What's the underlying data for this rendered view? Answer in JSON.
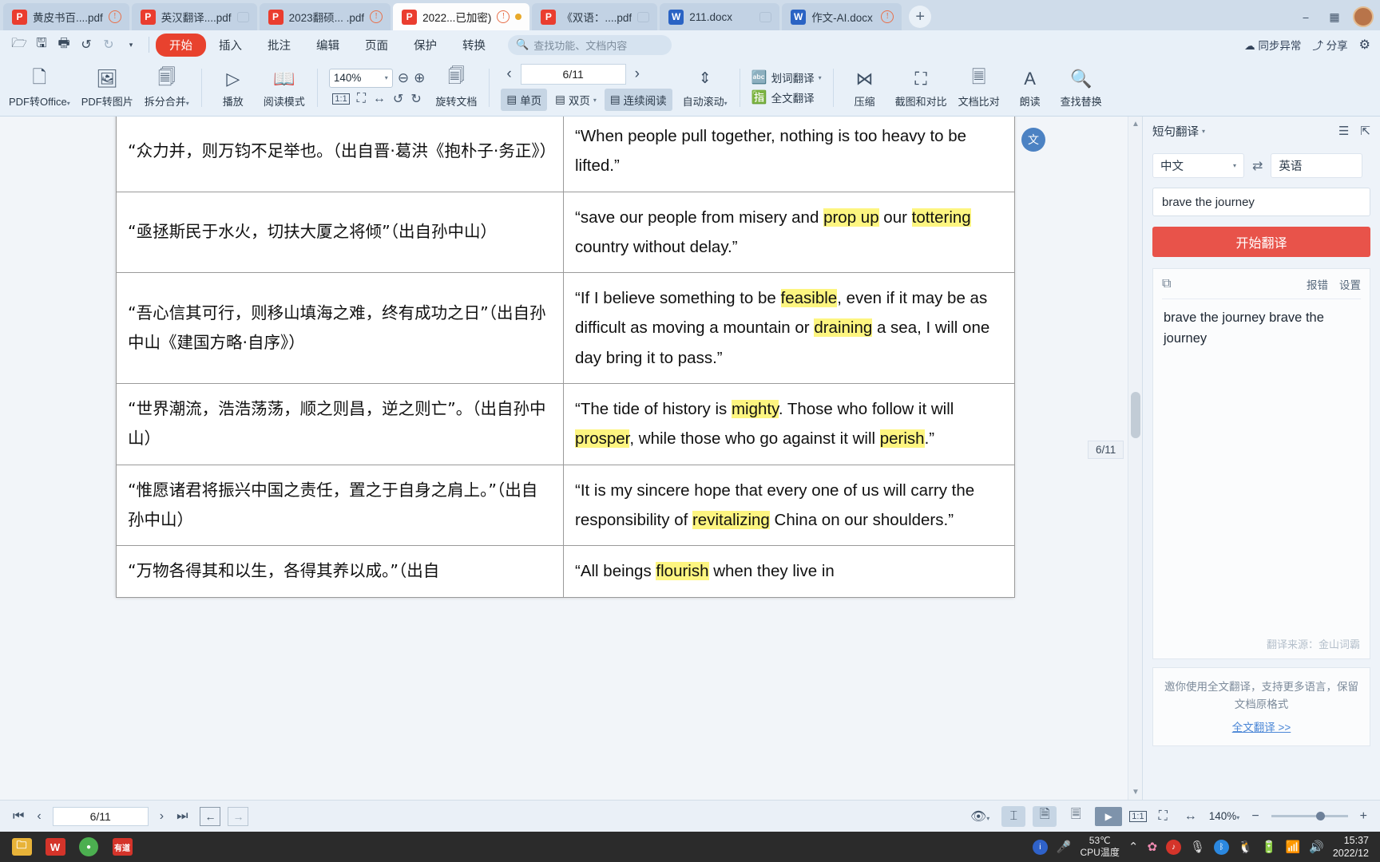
{
  "tabbar": {
    "tabs": [
      {
        "icon": "pdf-file-icon",
        "title": "黄皮书百....pdf",
        "active": false,
        "badges": [
          "warning-icon"
        ]
      },
      {
        "icon": "pdf-file-icon",
        "title": "英汉翻译....pdf",
        "active": false,
        "badges": [
          "chat-icon"
        ]
      },
      {
        "icon": "pdf-file-icon",
        "title": "2023翻硕... .pdf",
        "active": false,
        "badges": [
          "warning-icon"
        ]
      },
      {
        "icon": "pdf-file-icon",
        "title": "2022...已加密)",
        "active": true,
        "badges": [
          "warning-icon",
          "dot-icon"
        ]
      },
      {
        "icon": "pdf-file-icon",
        "title": "《双语：....pdf",
        "active": false,
        "badges": [
          "chat-icon"
        ]
      },
      {
        "icon": "word-file-icon",
        "title": "211.docx",
        "active": false,
        "badges": [
          "chat-icon"
        ]
      },
      {
        "icon": "word-file-icon",
        "title": "作文-AI.docx",
        "active": false,
        "badges": [
          "warning-icon"
        ]
      }
    ],
    "new_tab": "+",
    "window_buttons": [
      "minimize",
      "maximize",
      "grid"
    ]
  },
  "menubar": {
    "quick_icons": [
      "open-folder-icon",
      "save-icon",
      "print-icon",
      "undo-icon",
      "redo-icon",
      "more-icon"
    ],
    "items": [
      "开始",
      "插入",
      "批注",
      "编辑",
      "页面",
      "保护",
      "转换"
    ],
    "active_item": "开始",
    "search_placeholder": "查找功能、文档内容",
    "sync_status": "同步异常",
    "share": "分享",
    "settings_icon": "gear-icon"
  },
  "ribbon": {
    "buttons": [
      {
        "label": "PDF转Office",
        "icon": "pdf-to-office-icon",
        "caret": true
      },
      {
        "label": "PDF转图片",
        "icon": "pdf-to-image-icon",
        "caret": false
      },
      {
        "label": "拆分合并",
        "icon": "split-merge-icon",
        "caret": true
      },
      {
        "label": "播放",
        "icon": "play-icon",
        "caret": false
      },
      {
        "label": "阅读模式",
        "icon": "book-icon",
        "caret": false
      }
    ],
    "zoom": {
      "value": "140%",
      "zoom_out_icon": "zoom-out-icon",
      "zoom_in_icon": "zoom-in-icon",
      "mini_icons": [
        "actual-size-icon",
        "fit-page-icon",
        "fit-width-icon",
        "rotate-left-icon",
        "rotate-right-icon"
      ]
    },
    "rotate_doc": {
      "label": "旋转文档",
      "icon": "rotate-document-icon"
    },
    "page_nav": {
      "prev": "‹",
      "value": "6/11",
      "next": "›"
    },
    "view_modes": [
      {
        "label": "单页",
        "icon": "single-page-icon",
        "on": true,
        "caret": false
      },
      {
        "label": "双页",
        "icon": "double-page-icon",
        "on": false,
        "caret": true
      },
      {
        "label": "连续阅读",
        "icon": "continuous-read-icon",
        "on": true,
        "caret": false
      }
    ],
    "auto_scroll": {
      "label": "自动滚动",
      "icon": "auto-scroll-icon",
      "caret": true
    },
    "translate_group": [
      {
        "label": "划词翻译",
        "icon": "word-translate-icon",
        "caret": true
      },
      {
        "label": "全文翻译",
        "icon": "full-translate-icon",
        "caret": false
      }
    ],
    "tools": [
      {
        "label": "压缩",
        "icon": "compress-icon"
      },
      {
        "label": "截图和对比",
        "icon": "screenshot-compare-icon"
      },
      {
        "label": "文档比对",
        "icon": "document-compare-icon"
      },
      {
        "label": "朗读",
        "icon": "read-aloud-icon"
      },
      {
        "label": "查找替换",
        "icon": "find-replace-icon"
      }
    ]
  },
  "document": {
    "page_tooltip": "6/11",
    "rows": [
      {
        "zh": "“众力并，则万钧不足举也。（出自晋·葛洪《抱朴子·务正》）",
        "en_parts": [
          {
            "t": "“When people pull together, nothing is too heavy to be lifted.”",
            "h": false
          }
        ]
      },
      {
        "zh": "“亟拯斯民于水火，切扶大厦之将倾”（出自孙中山）",
        "en_parts": [
          {
            "t": "“save our people from misery and ",
            "h": false
          },
          {
            "t": "prop up",
            "h": true
          },
          {
            "t": " our ",
            "h": false
          },
          {
            "t": "tottering",
            "h": true
          },
          {
            "t": " country without delay.”",
            "h": false
          }
        ]
      },
      {
        "zh": "“吾心信其可行，则移山填海之难，终有成功之日”（出自孙中山《建国方略·自序》）",
        "en_parts": [
          {
            "t": "“If I believe something to be ",
            "h": false
          },
          {
            "t": "feasible",
            "h": true
          },
          {
            "t": ", even if it may be as difficult as moving a mountain or ",
            "h": false
          },
          {
            "t": "draining",
            "h": true
          },
          {
            "t": " a sea, I will one day bring it to pass.”",
            "h": false
          }
        ]
      },
      {
        "zh": "“世界潮流，浩浩荡荡，顺之则昌，逆之则亡”。（出自孙中山）",
        "en_parts": [
          {
            "t": "“The tide of history is ",
            "h": false
          },
          {
            "t": "mighty",
            "h": true
          },
          {
            "t": ". Those who follow it will ",
            "h": false
          },
          {
            "t": "prosper",
            "h": true
          },
          {
            "t": ", while those who go against it will ",
            "h": false
          },
          {
            "t": "perish",
            "h": true
          },
          {
            "t": ".”",
            "h": false
          }
        ]
      },
      {
        "zh": "“惟愿诸君将振兴中国之责任，置之于自身之肩上。”（出自孙中山）",
        "en_parts": [
          {
            "t": "“It is my sincere hope that every one of us will carry the responsibility of ",
            "h": false
          },
          {
            "t": "revitalizing",
            "h": true
          },
          {
            "t": " China on our shoulders.”",
            "h": false
          }
        ]
      },
      {
        "zh": "“万物各得其和以生，各得其养以成。”（出自",
        "en_parts": [
          {
            "t": "“All beings ",
            "h": false
          },
          {
            "t": "flourish",
            "h": true
          },
          {
            "t": " when they live in",
            "h": false
          }
        ]
      }
    ]
  },
  "translate_panel": {
    "title": "短句翻译",
    "menu_icon": "menu-icon",
    "pin_icon": "pin-icon",
    "source_lang": "中文",
    "target_lang": "英语",
    "swap_icon": "swap-icon",
    "input_value": "brave the journey",
    "translate_button": "开始翻译",
    "copy_icon": "copy-icon",
    "report_error": "报错",
    "settings": "设置",
    "result_text": "brave the journey brave the journey",
    "source_note": "翻译来源：金山词霸",
    "promo_text": "邀你使用全文翻译，支持更多语言，保留文档原格式",
    "promo_link": "全文翻译 >>"
  },
  "statusbar": {
    "first_icon": "first-page-icon",
    "prev_icon": "prev-page-icon",
    "page_value": "6/11",
    "next_icon": "next-page-icon",
    "last_icon": "last-page-icon",
    "back_icon": "back-arrow-icon",
    "forward_icon": "forward-arrow-icon",
    "eye_icon": "eye-icon",
    "fit_icon": "fit-width-icon",
    "single_page_icon": "single-page-icon",
    "double_page_icon": "double-page-icon",
    "play_icon": "play-icon",
    "actual_size_icon": "actual-size-icon",
    "fit_page_icon": "fit-page-icon",
    "fit_width_icon2": "fit-width-icon",
    "zoom_label": "140%",
    "zoom_out": "−",
    "zoom_in": "+"
  },
  "taskbar": {
    "apps": [
      {
        "name": "file-explorer-icon",
        "color": "#e8b339"
      },
      {
        "name": "wps-icon",
        "color": "#d4342a"
      },
      {
        "name": "browser-icon",
        "color": "#4caf50"
      },
      {
        "name": "youdao-icon",
        "color": "#d4342a"
      }
    ],
    "tray": {
      "ifly_icon": "ifly-icon",
      "mic_icon": "microphone-icon",
      "temp_value": "53℃",
      "temp_label": "CPU温度",
      "chevron_icon": "chevron-up-icon",
      "icons": [
        "flower-icon",
        "qq-music-icon",
        "microphone-icon",
        "bluetooth-icon",
        "qq-penguin-icon",
        "battery-icon",
        "wifi-icon",
        "volume-icon"
      ],
      "time": "15:37",
      "date": "2022/12"
    }
  }
}
